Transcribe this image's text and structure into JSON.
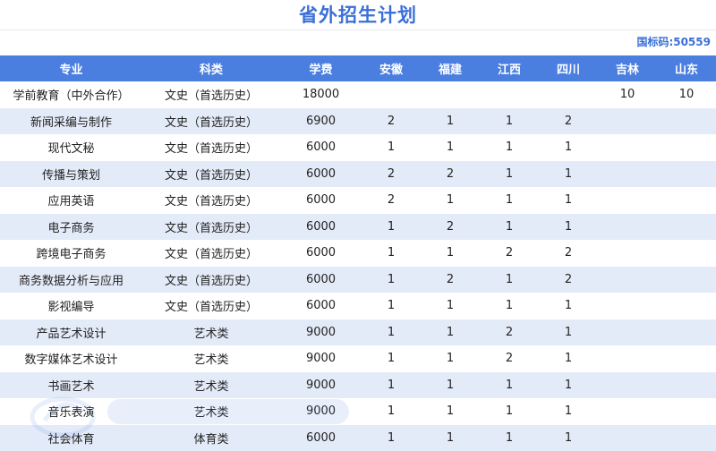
{
  "page_title": "省外招生计划",
  "school_code": "国标码:50559",
  "columns": [
    "专业",
    "科类",
    "学费",
    "安徽",
    "福建",
    "江西",
    "四川",
    "吉林",
    "山东"
  ],
  "rows": [
    [
      "学前教育（中外合作）",
      "文史（首选历史）",
      "18000",
      "",
      "",
      "",
      "",
      "10",
      "10"
    ],
    [
      "新闻采编与制作",
      "文史（首选历史）",
      "6900",
      "2",
      "1",
      "1",
      "2",
      "",
      ""
    ],
    [
      "现代文秘",
      "文史（首选历史）",
      "6000",
      "1",
      "1",
      "1",
      "1",
      "",
      ""
    ],
    [
      "传播与策划",
      "文史（首选历史）",
      "6000",
      "2",
      "2",
      "1",
      "1",
      "",
      ""
    ],
    [
      "应用英语",
      "文史（首选历史）",
      "6000",
      "2",
      "1",
      "1",
      "1",
      "",
      ""
    ],
    [
      "电子商务",
      "文史（首选历史）",
      "6000",
      "1",
      "2",
      "1",
      "1",
      "",
      ""
    ],
    [
      "跨境电子商务",
      "文史（首选历史）",
      "6000",
      "1",
      "1",
      "2",
      "2",
      "",
      ""
    ],
    [
      "商务数据分析与应用",
      "文史（首选历史）",
      "6000",
      "1",
      "2",
      "1",
      "2",
      "",
      ""
    ],
    [
      "影视编导",
      "文史（首选历史）",
      "6000",
      "1",
      "1",
      "1",
      "1",
      "",
      ""
    ],
    [
      "产品艺术设计",
      "艺术类",
      "9000",
      "1",
      "1",
      "2",
      "1",
      "",
      ""
    ],
    [
      "数字媒体艺术设计",
      "艺术类",
      "9000",
      "1",
      "1",
      "2",
      "1",
      "",
      ""
    ],
    [
      "书画艺术",
      "艺术类",
      "9000",
      "1",
      "1",
      "1",
      "1",
      "",
      ""
    ],
    [
      "音乐表演",
      "艺术类",
      "9000",
      "1",
      "1",
      "1",
      "1",
      "",
      ""
    ],
    [
      "社会体育",
      "体育类",
      "6000",
      "1",
      "1",
      "1",
      "1",
      "",
      ""
    ]
  ],
  "colors": {
    "accent": "#3a6fd8",
    "header_bg": "#4a7fe0",
    "stripe": "#e4ebf8"
  }
}
